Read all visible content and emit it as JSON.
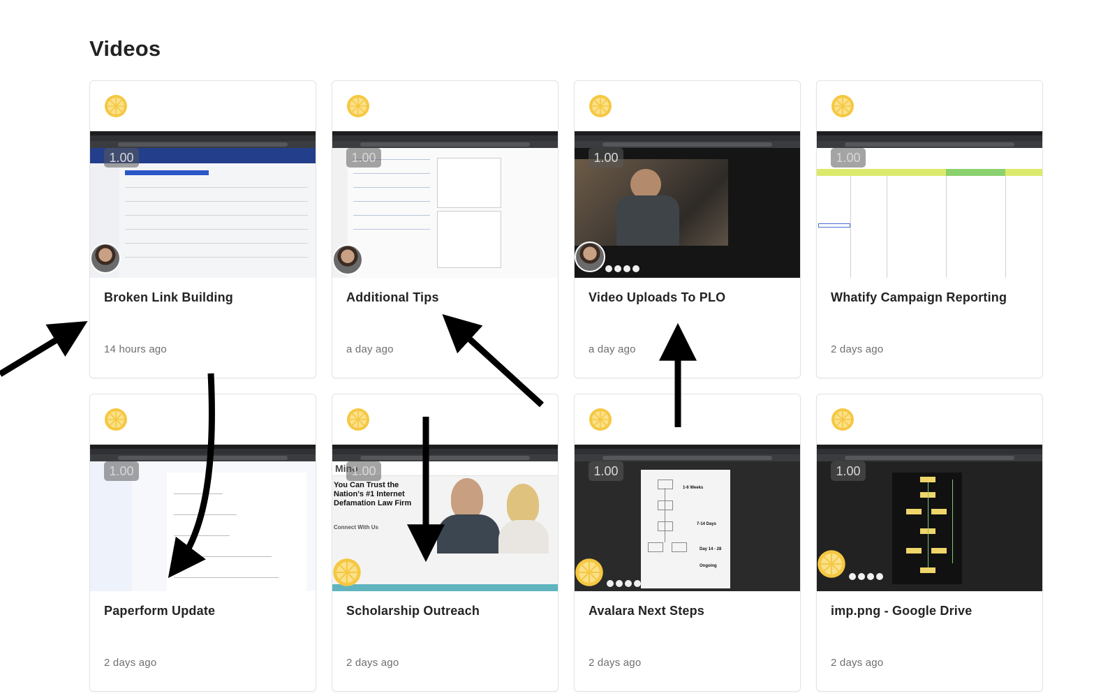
{
  "page": {
    "title": "Videos"
  },
  "colors": {
    "brand_logo": "#f5c842",
    "arrow": "#000000"
  },
  "videos": [
    {
      "title": "Broken Link Building",
      "age": "14 hours ago",
      "speed": "1.00"
    },
    {
      "title": "Additional Tips",
      "age": "a day ago",
      "speed": "1.00"
    },
    {
      "title": "Video Uploads To PLO",
      "age": "a day ago",
      "speed": "1.00"
    },
    {
      "title": "Whatify Campaign Reporting",
      "age": "2 days ago",
      "speed": "1.00"
    },
    {
      "title": "Paperform Update",
      "age": "2 days ago",
      "speed": "1.00"
    },
    {
      "title": "Scholarship Outreach",
      "age": "2 days ago",
      "speed": "1.00",
      "screen_text": {
        "headline": "You Can Trust the Nation's #1 Internet Defamation Law Firm",
        "brand": "Mino",
        "cta": "Connect With Us"
      }
    },
    {
      "title": "Avalara Next Steps",
      "age": "2 days ago",
      "speed": "1.00",
      "screen_text": {
        "phase1": "1-6 Weeks",
        "phase2": "7-14 Days",
        "phase3": "Day 14 - 28",
        "phase4": "Ongoing"
      }
    },
    {
      "title": "imp.png - Google Drive",
      "age": "2 days ago",
      "speed": "1.00"
    }
  ]
}
